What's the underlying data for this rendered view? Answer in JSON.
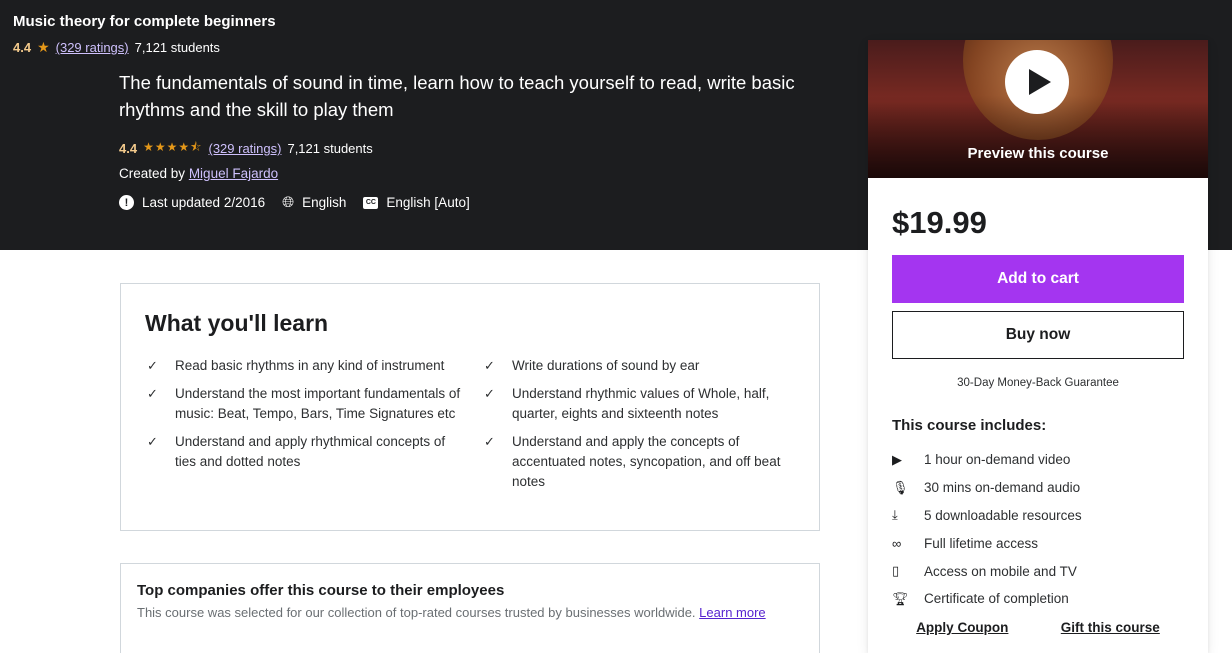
{
  "sticky": {
    "title": "Music theory for complete beginners",
    "rating": "4.4",
    "ratings_link": "(329 ratings)",
    "students": "7,121 students"
  },
  "hero": {
    "subtitle": "The fundamentals of sound in time, learn how to teach yourself to read, write basic rhythms and the skill to play them",
    "rating": "4.4",
    "stars": "★★★★⯪",
    "ratings_link": "(329 ratings)",
    "students": "7,121 students",
    "created_label": "Created by",
    "instructor": "Miguel Fajardo",
    "last_updated": "Last updated 2/2016",
    "language": "English",
    "captions": "English [Auto]"
  },
  "learn": {
    "title": "What you'll learn",
    "left": [
      "Read basic rhythms in any kind of instrument",
      "Understand the most important fundamentals of music: Beat, Tempo, Bars, Time Signatures etc",
      "Understand and apply rhythmical concepts of ties and dotted notes"
    ],
    "right": [
      "Write durations of sound by ear",
      "Understand rhythmic values of Whole, half, quarter, eights and sixteenth notes",
      "Understand and apply the concepts of accentuated notes, syncopation, and off beat notes"
    ]
  },
  "companies": {
    "title": "Top companies offer this course to their employees",
    "text": "This course was selected for our collection of top-rated courses trusted by businesses worldwide.",
    "learn_more": "Learn more"
  },
  "sidebar": {
    "preview_label": "Preview this course",
    "price": "$19.99",
    "add_to_cart": "Add to cart",
    "buy_now": "Buy now",
    "guarantee": "30-Day Money-Back Guarantee",
    "includes_title": "This course includes:",
    "includes": [
      {
        "icon": "video-icon",
        "text": "1 hour on-demand video"
      },
      {
        "icon": "microphone-icon",
        "text": "30 mins on-demand audio"
      },
      {
        "icon": "download-icon",
        "text": "5 downloadable resources"
      },
      {
        "icon": "infinity-icon",
        "text": "Full lifetime access"
      },
      {
        "icon": "mobile-icon",
        "text": "Access on mobile and TV"
      },
      {
        "icon": "trophy-icon",
        "text": "Certificate of completion"
      }
    ],
    "apply_coupon": "Apply Coupon",
    "gift_course": "Gift this course"
  },
  "colors": {
    "hero_bg": "#1c1d1f",
    "accent_purple": "#a435f0",
    "rating_gold": "#f3ca8c",
    "star_orange": "#e59819",
    "link_lavender": "#cec0fc"
  }
}
